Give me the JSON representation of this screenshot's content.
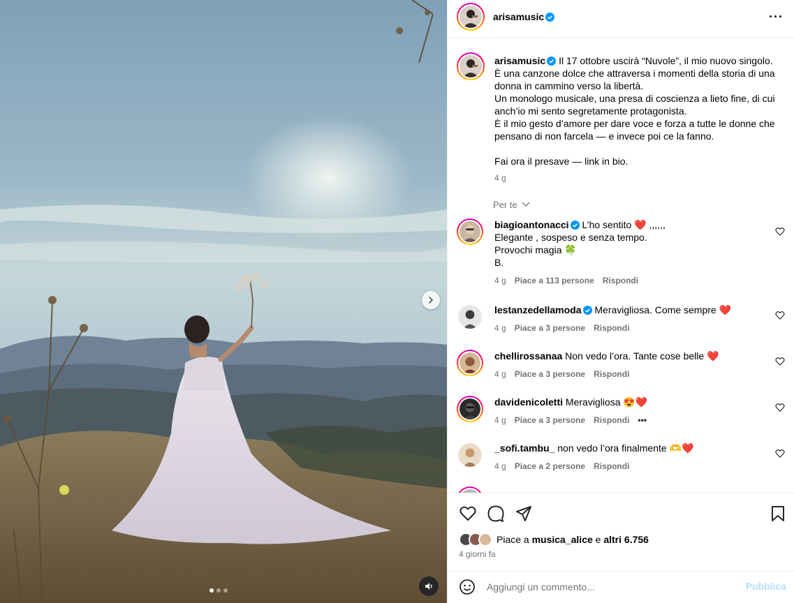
{
  "post": {
    "author": "arisamusic",
    "verified": true,
    "caption": "Il 17 ottobre uscirà “Nuvole”, il mio nuovo singolo.\nÈ una canzone dolce che attraversa i momenti della storia di una donna in cammino verso la libertà.\nUn monologo musicale, una presa di coscienza a lieto fine, di cui anch’io mi sento segretamente protagonista.\nÈ il mio gesto d’amore per dare voce e forza a tutte le donne che pensano di non farcela — e invece poi ce la fanno.\n\nFai ora il presave — link in bio.",
    "caption_time": "4 g",
    "translate_label": "Per te",
    "icons": {
      "more": "more-horizontal-icon",
      "verified": "verified-badge-icon",
      "next": "chevron-right-icon",
      "audio": "speaker-icon"
    }
  },
  "media": {
    "carousel_index": 1,
    "carousel_count": 3
  },
  "comments": [
    {
      "username": "biagioantonacci",
      "verified": true,
      "text": "L’ho sentito ❤️ ,,,,,,\nElegante , sospeso e senza tempo.\nProvochi magia 🍀\nB.",
      "time": "4 g",
      "likes": "Piace a 113 persone",
      "reply": "Rispondi"
    },
    {
      "username": "lestanzedellamoda",
      "verified": true,
      "text": "Meravigliosa. Come sempre ❤️",
      "time": "4 g",
      "likes": "Piace a 3 persone",
      "reply": "Rispondi"
    },
    {
      "username": "chellirossanaa",
      "verified": false,
      "text": "Non vedo l’ora. Tante cose belle ❤️",
      "time": "4 g",
      "likes": "Piace a 3 persone",
      "reply": "Rispondi"
    },
    {
      "username": "davidenicoletti",
      "verified": false,
      "text": "Meravigliosa 😍❤️",
      "time": "4 g",
      "likes": "Piace a 3 persone",
      "reply": "Rispondi",
      "more": "•••"
    },
    {
      "username": "_sofi.tambu_",
      "verified": false,
      "text": "non vedo l’ora finalmente 🫶❤️",
      "time": "4 g",
      "likes": "Piace a 2 persone",
      "reply": "Rispondi"
    }
  ],
  "actions": {
    "likes_prefix": "Piace a",
    "likes_user": "musica_alice",
    "likes_mid": "e",
    "likes_count": "altri 6.756",
    "date": "4 giorni fa",
    "icons": [
      "heart-icon",
      "comment-icon",
      "share-icon",
      "bookmark-icon"
    ]
  },
  "add_comment": {
    "placeholder": "Aggiungi un commento...",
    "publish": "Pubblica",
    "icon": "emoji-icon"
  },
  "colors": {
    "publish": "#b2dffc",
    "verified": "#0095f6",
    "meta": "#737373"
  }
}
